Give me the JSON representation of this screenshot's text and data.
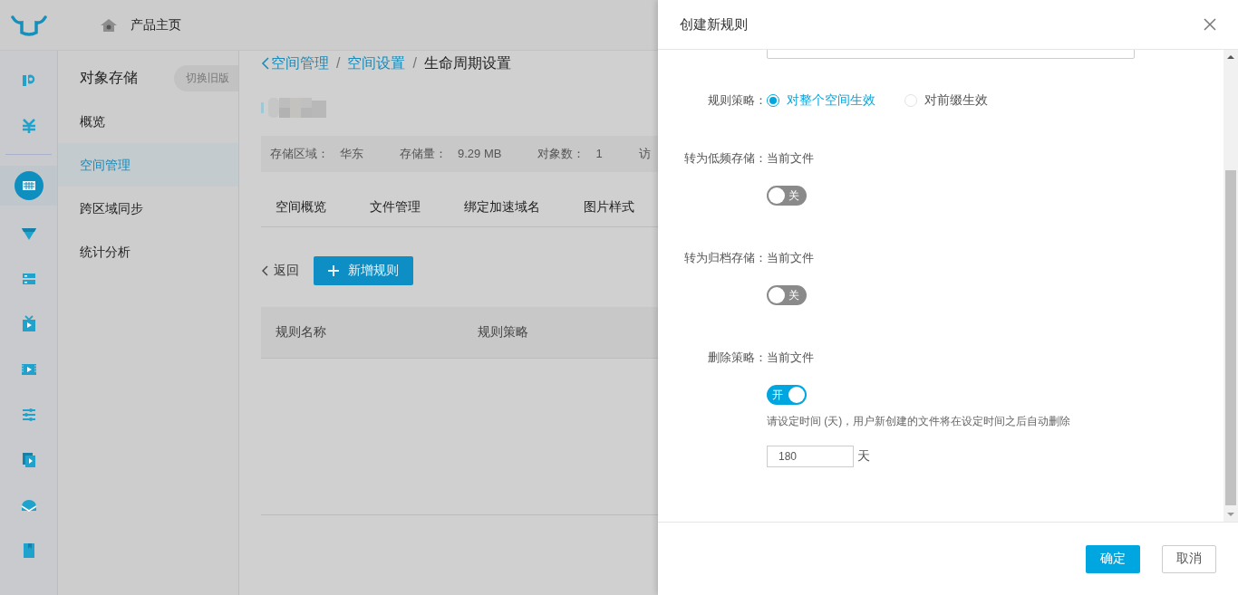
{
  "header": {
    "home_link": "产品主页"
  },
  "rail": {
    "items": [
      {
        "selected": false
      },
      {
        "selected": false
      },
      {
        "selected": true
      },
      {
        "selected": false
      },
      {
        "selected": false
      },
      {
        "selected": false
      },
      {
        "selected": false
      },
      {
        "selected": false
      },
      {
        "selected": false
      },
      {
        "selected": false
      },
      {
        "selected": false
      }
    ]
  },
  "sidebar": {
    "title": "对象存储",
    "switch_button": "切换旧版",
    "items": [
      {
        "label": "概览",
        "selected": false
      },
      {
        "label": "空间管理",
        "selected": true
      },
      {
        "label": "跨区域同步",
        "selected": false
      },
      {
        "label": "统计分析",
        "selected": false
      }
    ]
  },
  "breadcrumb": [
    {
      "kind": "link",
      "label": "空间管理"
    },
    {
      "kind": "separator",
      "label": "/"
    },
    {
      "kind": "link",
      "label": "空间设置"
    },
    {
      "kind": "separator",
      "label": "/"
    },
    {
      "kind": "current",
      "label": "生命周期设置"
    }
  ],
  "bucket_stats": [
    {
      "label": "存储区域：",
      "value": "华东"
    },
    {
      "label": "存储量：",
      "value": "9.29 MB"
    },
    {
      "label": "对象数：",
      "value": "1"
    },
    {
      "label": "访"
    }
  ],
  "tabs": [
    {
      "label": "空间概览",
      "selected": false
    },
    {
      "label": "文件管理",
      "selected": false
    },
    {
      "label": "绑定加速域名",
      "selected": false
    },
    {
      "label": "图片样式",
      "selected": false
    }
  ],
  "back_button": "返回",
  "add_rule_button": "新增规则",
  "table": {
    "columns": [
      "规则名称",
      "规则策略"
    ]
  },
  "drawer": {
    "title": "创建新规则",
    "strategy": {
      "label": "规则策略：",
      "options": [
        {
          "label": "对整个空间生效",
          "selected": true
        },
        {
          "label": "对前缀生效",
          "selected": false
        }
      ]
    },
    "sections": [
      {
        "label": "转为低频存储：",
        "scope": "当前文件",
        "on": false,
        "switch_text": "关"
      },
      {
        "label": "转为归档存储：",
        "scope": "当前文件",
        "on": false,
        "switch_text": "关"
      },
      {
        "label": "删除策略：",
        "scope": "当前文件",
        "on": true,
        "switch_text": "开",
        "hint": "请设定时间 (天)，用户新创建的文件将在设定时间之后自动删除",
        "days": {
          "value": "180",
          "unit": "天"
        }
      }
    ],
    "buttons": {
      "confirm": "确定",
      "cancel": "取消"
    }
  }
}
